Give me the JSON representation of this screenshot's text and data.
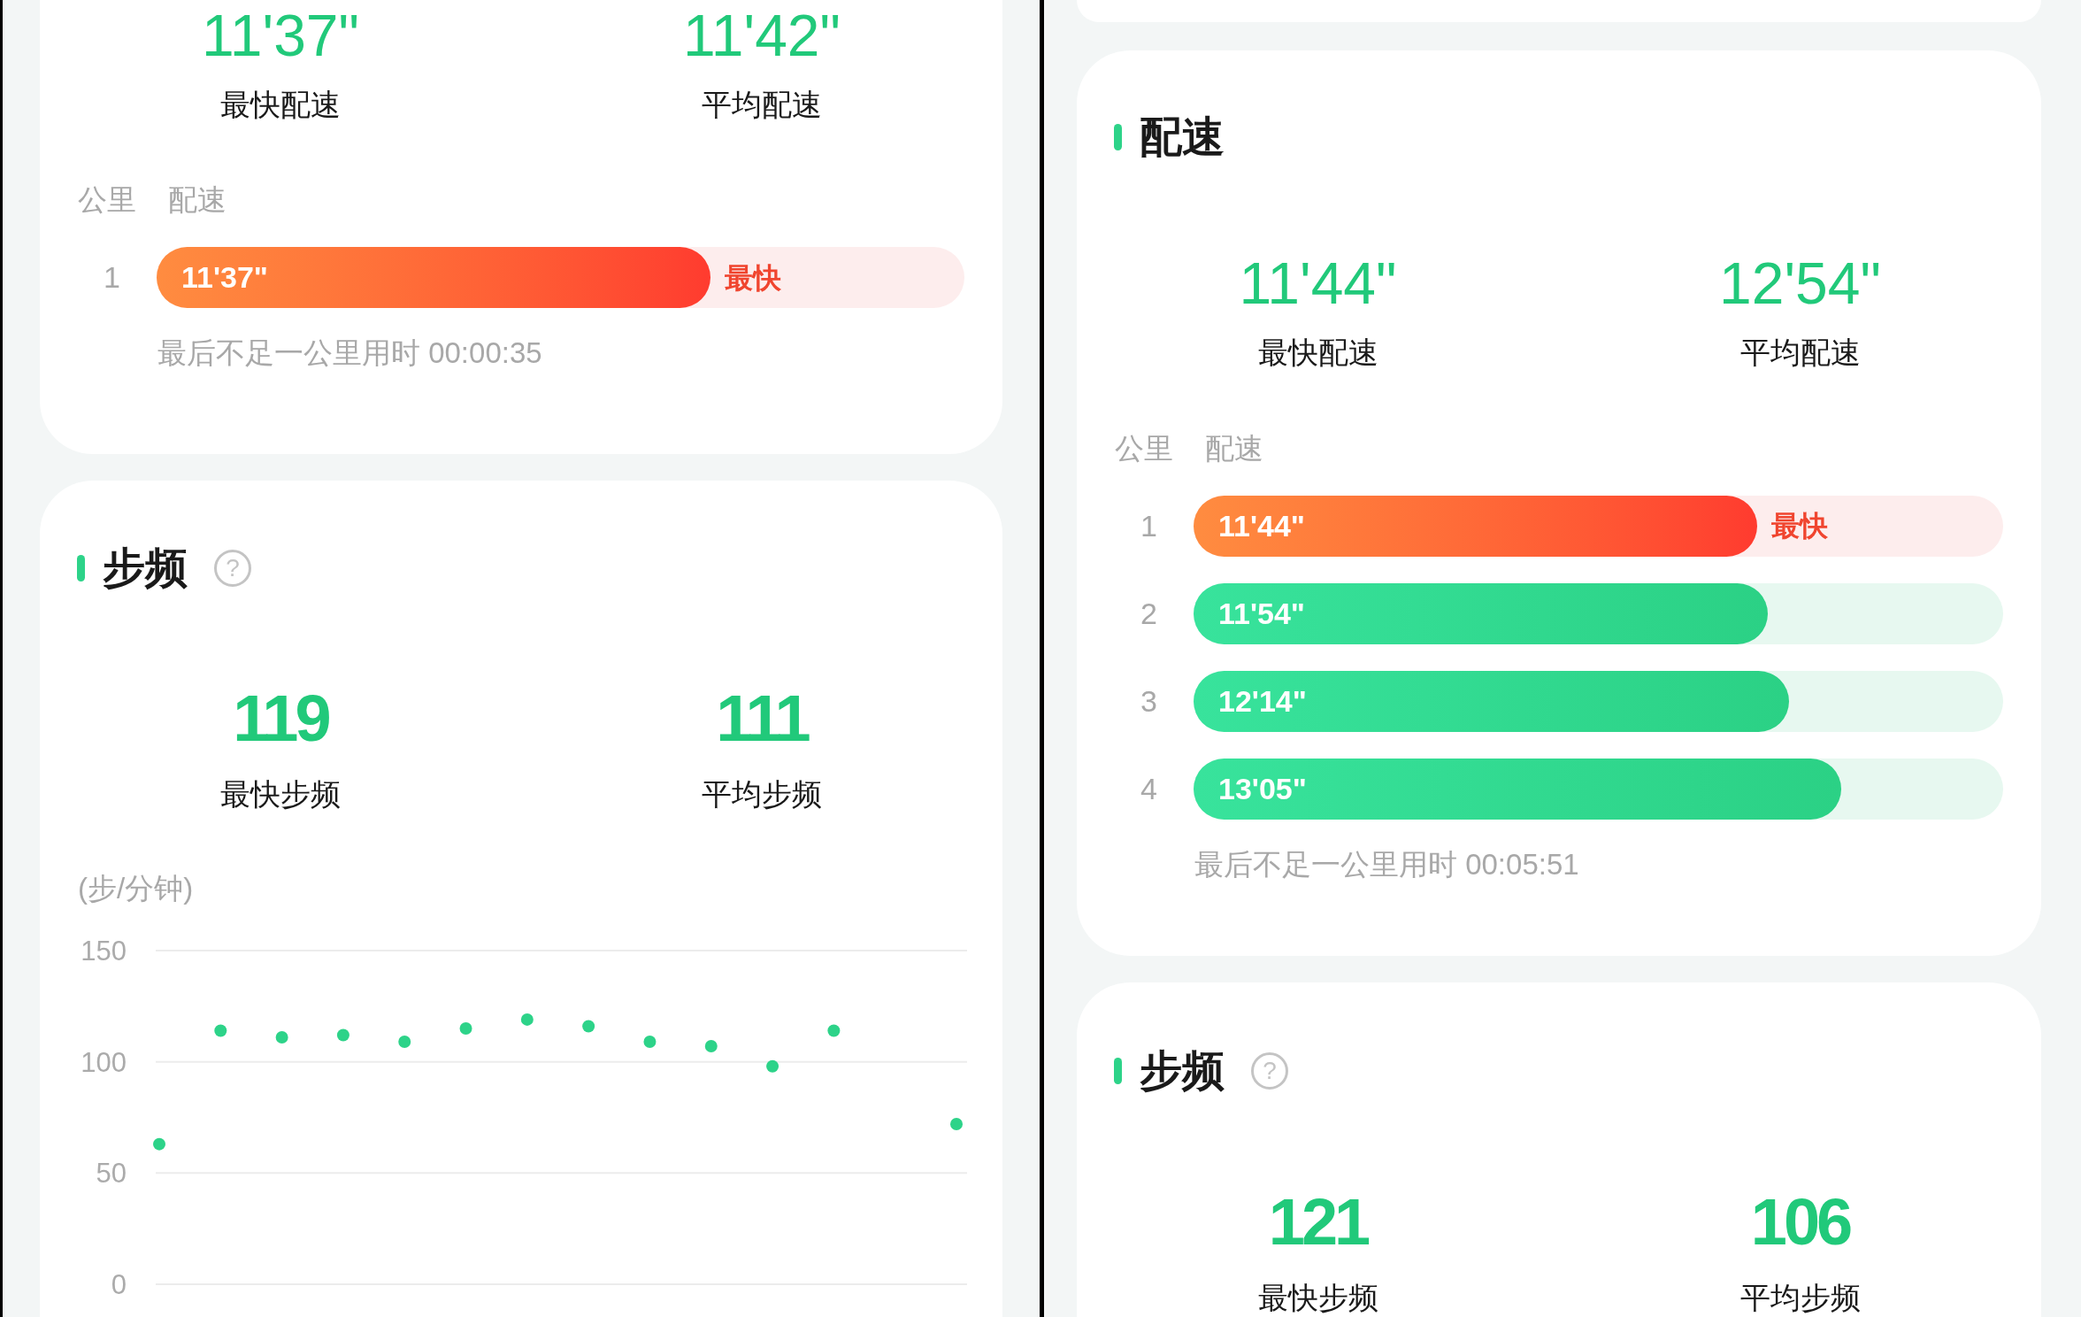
{
  "left": {
    "pace_card": {
      "stats": [
        {
          "value": "11'37\"",
          "label": "最快配速"
        },
        {
          "value": "11'42\"",
          "label": "平均配速"
        }
      ],
      "columns": [
        "公里",
        "配速"
      ],
      "splits": [
        {
          "km": "1",
          "pace": "11'37\"",
          "fastest": true,
          "badge": "最快",
          "level": 0.686
        }
      ],
      "remainder": "最后不足一公里用时 00:00:35"
    },
    "cadence_card": {
      "title": "步频",
      "help": "?",
      "stats": [
        {
          "value": "119",
          "label": "最快步频"
        },
        {
          "value": "111",
          "label": "平均步频"
        }
      ],
      "chart_data": {
        "type": "scatter",
        "ylabel": "(步/分钟)",
        "ylim": [
          0,
          150
        ],
        "yticks": [
          0,
          50,
          100,
          150
        ],
        "series": [
          {
            "color": "#2dd389",
            "values": [
              63,
              114,
              111,
              112,
              109,
              115,
              119,
              116,
              109,
              107,
              98,
              114,
              null,
              72
            ]
          }
        ]
      }
    }
  },
  "right": {
    "pace_card": {
      "title": "配速",
      "stats": [
        {
          "value": "11'44\"",
          "label": "最快配速"
        },
        {
          "value": "12'54\"",
          "label": "平均配速"
        }
      ],
      "columns": [
        "公里",
        "配速"
      ],
      "splits": [
        {
          "km": "1",
          "pace": "11'44\"",
          "fastest": true,
          "badge": "最快",
          "level": 0.696
        },
        {
          "km": "2",
          "pace": "11'54\"",
          "fastest": false,
          "level": 0.709
        },
        {
          "km": "3",
          "pace": "12'14\"",
          "fastest": false,
          "level": 0.735
        },
        {
          "km": "4",
          "pace": "13'05\"",
          "fastest": false,
          "level": 0.8
        }
      ],
      "remainder": "最后不足一公里用时 00:05:51"
    },
    "cadence_card": {
      "title": "步频",
      "help": "?",
      "stats": [
        {
          "value": "121",
          "label": "最快步频"
        },
        {
          "value": "106",
          "label": "平均步频"
        }
      ]
    }
  }
}
